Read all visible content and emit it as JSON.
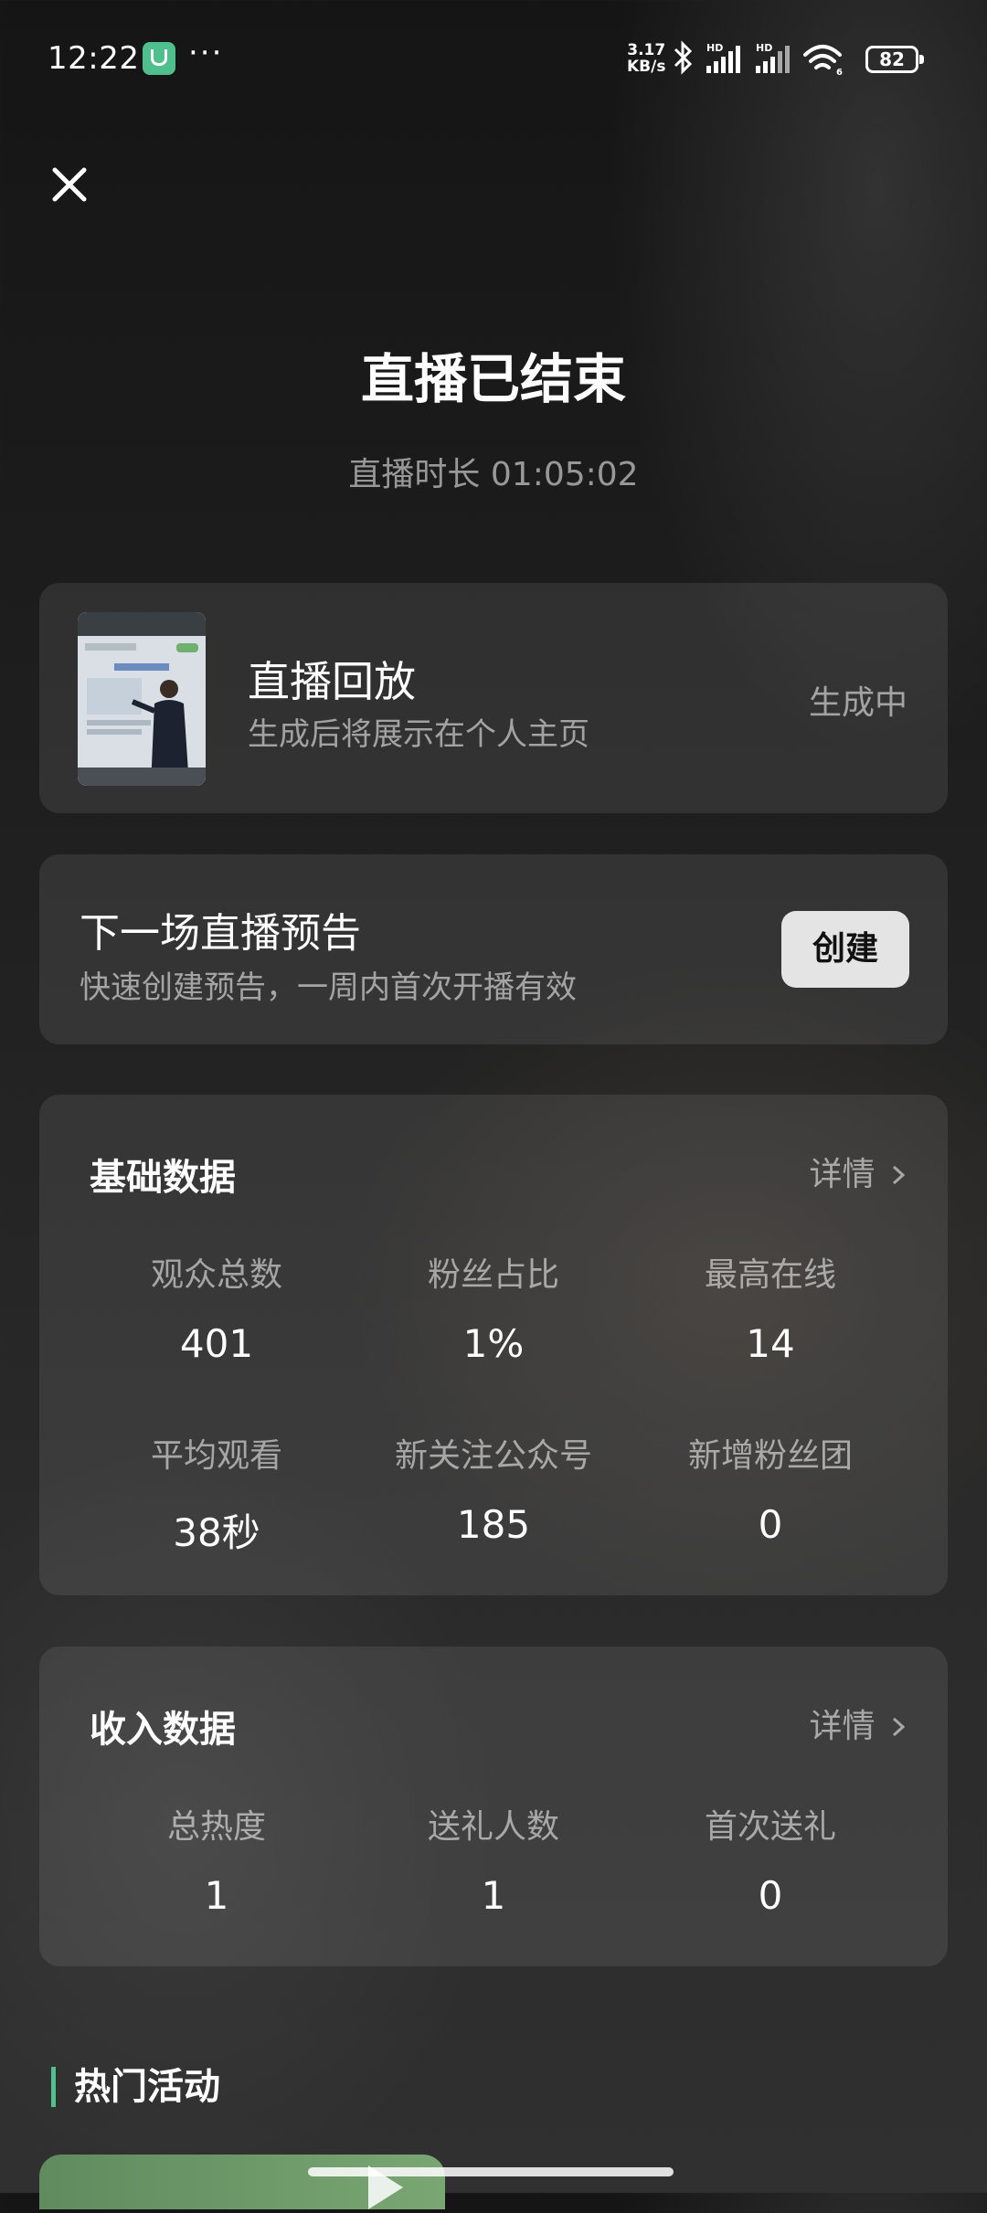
{
  "status_bar": {
    "time": "12:22",
    "more": "···",
    "net_speed_value": "3.17",
    "net_speed_unit": "KB/s",
    "signal_label_1": "HD",
    "signal_label_2": "HD",
    "wifi_badge": "6",
    "battery": "82"
  },
  "header": {
    "title": "直播已结束",
    "duration_label": "直播时长",
    "duration_value": "01:05:02"
  },
  "replay": {
    "title": "直播回放",
    "subtitle": "生成后将展示在个人主页",
    "status": "生成中"
  },
  "preview": {
    "title": "下一场直播预告",
    "subtitle": "快速创建预告，一周内首次开播有效",
    "button": "创建"
  },
  "basic_stats": {
    "title": "基础数据",
    "detail": "详情",
    "items": [
      {
        "label": "观众总数",
        "value": "401"
      },
      {
        "label": "粉丝占比",
        "value": "1%"
      },
      {
        "label": "最高在线",
        "value": "14"
      },
      {
        "label": "平均观看",
        "value": "38秒"
      },
      {
        "label": "新关注公众号",
        "value": "185"
      },
      {
        "label": "新增粉丝团",
        "value": "0"
      }
    ]
  },
  "income_stats": {
    "title": "收入数据",
    "detail": "详情",
    "items": [
      {
        "label": "总热度",
        "value": "1"
      },
      {
        "label": "送礼人数",
        "value": "1"
      },
      {
        "label": "首次送礼",
        "value": "0"
      }
    ]
  },
  "activities": {
    "title": "热门活动"
  },
  "colors": {
    "accent": "#4fc08d",
    "card_bg": "rgba(255,255,255,0.085)",
    "button_bg": "#e4e4e4"
  }
}
